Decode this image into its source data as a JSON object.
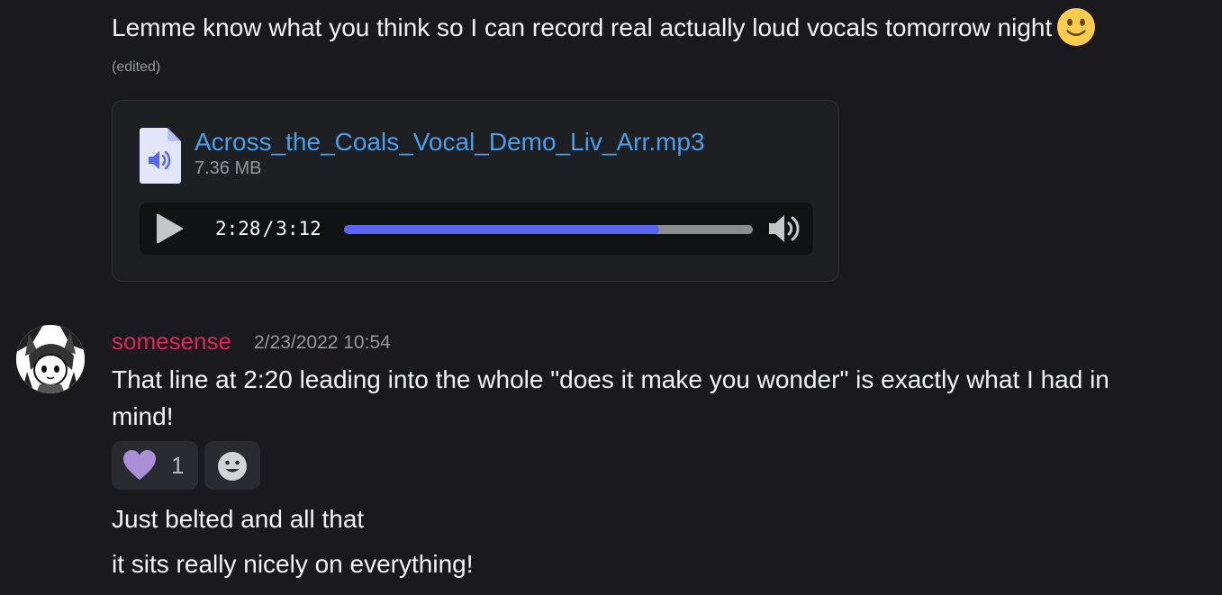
{
  "messages": [
    {
      "text": "Lemme know what you think so I can record real actually loud vocals tomorrow night",
      "emoji": "slightly-smiling-face",
      "edited_label": "(edited)",
      "attachment": {
        "filename": "Across_the_Coals_Vocal_Demo_Liv_Arr.mp3",
        "size": "7.36 MB",
        "player": {
          "current_time": "2:28",
          "separator": "/",
          "duration": "3:12",
          "progress_fraction": 0.77
        }
      }
    },
    {
      "author": "somesense",
      "author_color": "#e0245e",
      "timestamp": "2/23/2022 10:54",
      "text": "That line at 2:20 leading into the whole \"does it make you wonder\" is exactly what I had in mind!",
      "reactions": [
        {
          "icon": "purple-heart-icon",
          "count": "1"
        }
      ],
      "add_reaction_icon": "add-reaction-icon"
    },
    {
      "text": "Just belted and all that"
    },
    {
      "text": "it sits really nicely on everything!"
    }
  ],
  "colors": {
    "background": "#1a1a1e",
    "link": "#4a9fe8",
    "progress": "#5865f2",
    "heart": "#aa8ed6"
  }
}
